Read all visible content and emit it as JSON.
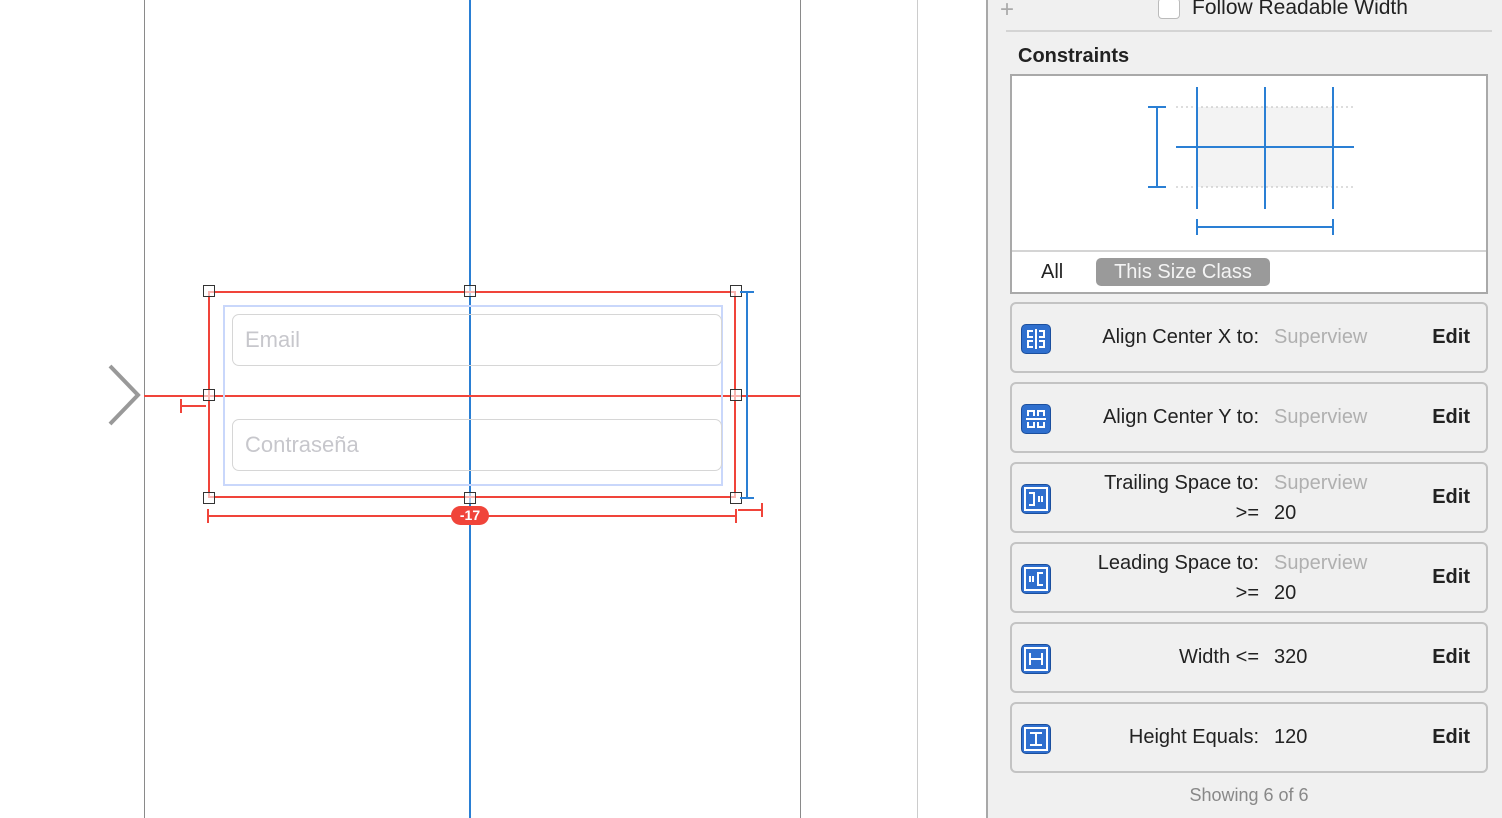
{
  "canvas": {
    "email_placeholder": "Email",
    "password_placeholder": "Contraseña",
    "conflict_badge": "-17",
    "colors": {
      "constraint_error": "#f0443a",
      "constraint_ok": "#2a7fd4"
    }
  },
  "inspector": {
    "add_icon": "plus-icon",
    "follow_readable_width": {
      "label": "Follow Readable Width",
      "checked": false
    },
    "constraints_title": "Constraints",
    "filter_all": "All",
    "filter_size_class": "This Size Class",
    "constraints": [
      {
        "icon": "align-center-x-icon",
        "label": "Align Center X to:",
        "target": "Superview",
        "action": "Edit"
      },
      {
        "icon": "align-center-y-icon",
        "label": "Align Center Y to:",
        "target": "Superview",
        "action": "Edit"
      },
      {
        "icon": "trailing-space-icon",
        "label": "Trailing Space to:",
        "target": "Superview",
        "relation": ">=",
        "value": "20",
        "action": "Edit"
      },
      {
        "icon": "leading-space-icon",
        "label": "Leading Space to:",
        "target": "Superview",
        "relation": ">=",
        "value": "20",
        "action": "Edit"
      },
      {
        "icon": "width-icon",
        "label": "Width <=",
        "value": "320",
        "action": "Edit"
      },
      {
        "icon": "height-icon",
        "label": "Height Equals:",
        "value": "120",
        "action": "Edit"
      }
    ],
    "footer": "Showing 6 of 6"
  }
}
